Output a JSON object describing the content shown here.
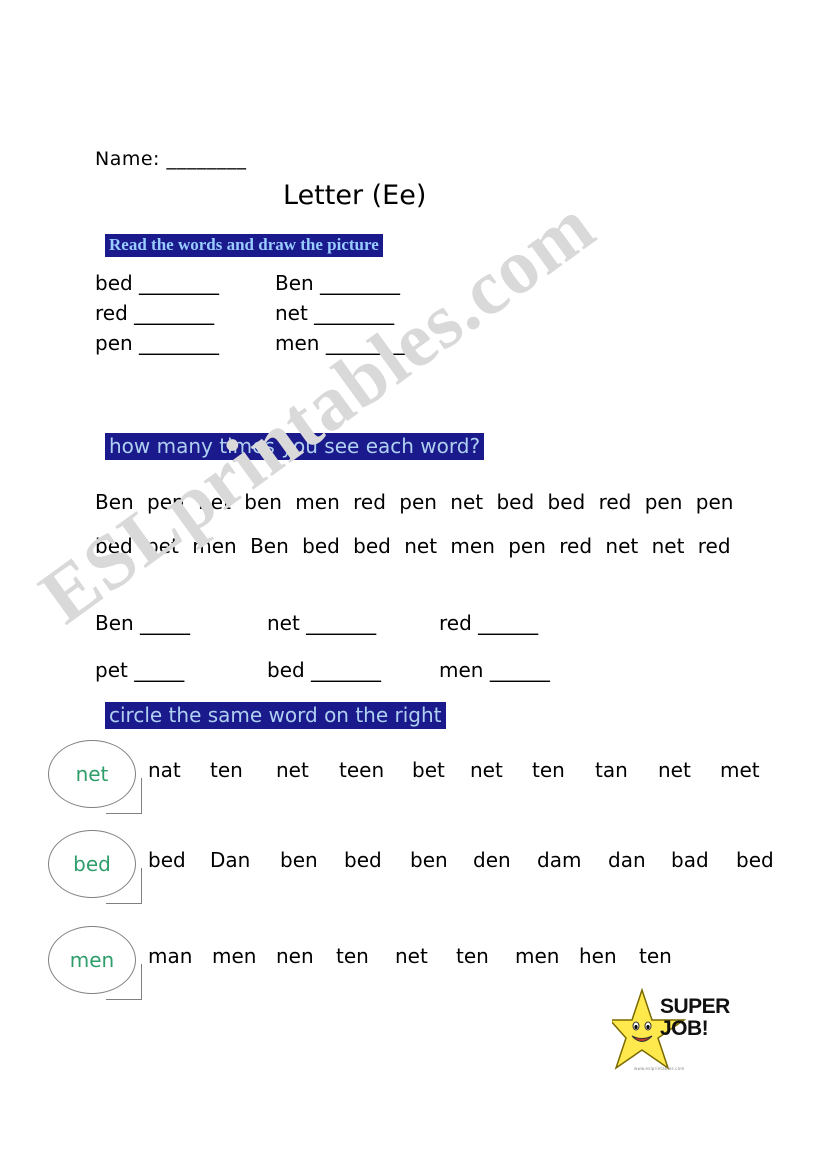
{
  "document": {
    "name_label": "Name: ________",
    "title": "Letter (Ee)",
    "watermark": "ESLprintables.com"
  },
  "section1": {
    "heading": "Read the words and draw the picture",
    "rows": [
      {
        "left": "bed ________",
        "right": "Ben ________"
      },
      {
        "left": "red ________",
        "right": "net ________"
      },
      {
        "left": "pen ________",
        "right": "men ________"
      }
    ]
  },
  "section2": {
    "heading": "how many times you see each word?",
    "line1": "Ben  pen  net  ben  men  red  pen  net  bed  bed  red  pen  pen",
    "line2": "bed  pet  men  Ben  bed  bed net  men  pen  red  net  net  red",
    "answers": [
      {
        "a": "Ben _____",
        "b": "net _______",
        "c": "red ______"
      },
      {
        "a": "pet _____",
        "b": "bed _______",
        "c": "men ______"
      }
    ]
  },
  "section3": {
    "heading": "circle the same word on the right",
    "rows": [
      {
        "target": "net",
        "words": [
          "nat",
          "ten",
          "net",
          "teen",
          "bet",
          "net",
          "ten",
          "tan",
          "net",
          "met"
        ]
      },
      {
        "target": "bed",
        "words": [
          "bed",
          "Dan",
          "ben",
          "bed",
          "ben",
          "den",
          "dam",
          "dan",
          "bad",
          "bed"
        ]
      },
      {
        "target": "men",
        "words": [
          "man",
          "men",
          "nen",
          "ten",
          "net",
          "ten",
          "men",
          "hen",
          "ten"
        ]
      }
    ]
  },
  "sticker": {
    "line1": "SUPER",
    "line2": "JOB!",
    "caption": "www.eslprintables.com"
  },
  "colors": {
    "heading_bg": "#1a1a8c",
    "heading_text": "#99ccff",
    "bubble_word": "#2e9e6b",
    "watermark": "#d9d9d9"
  }
}
